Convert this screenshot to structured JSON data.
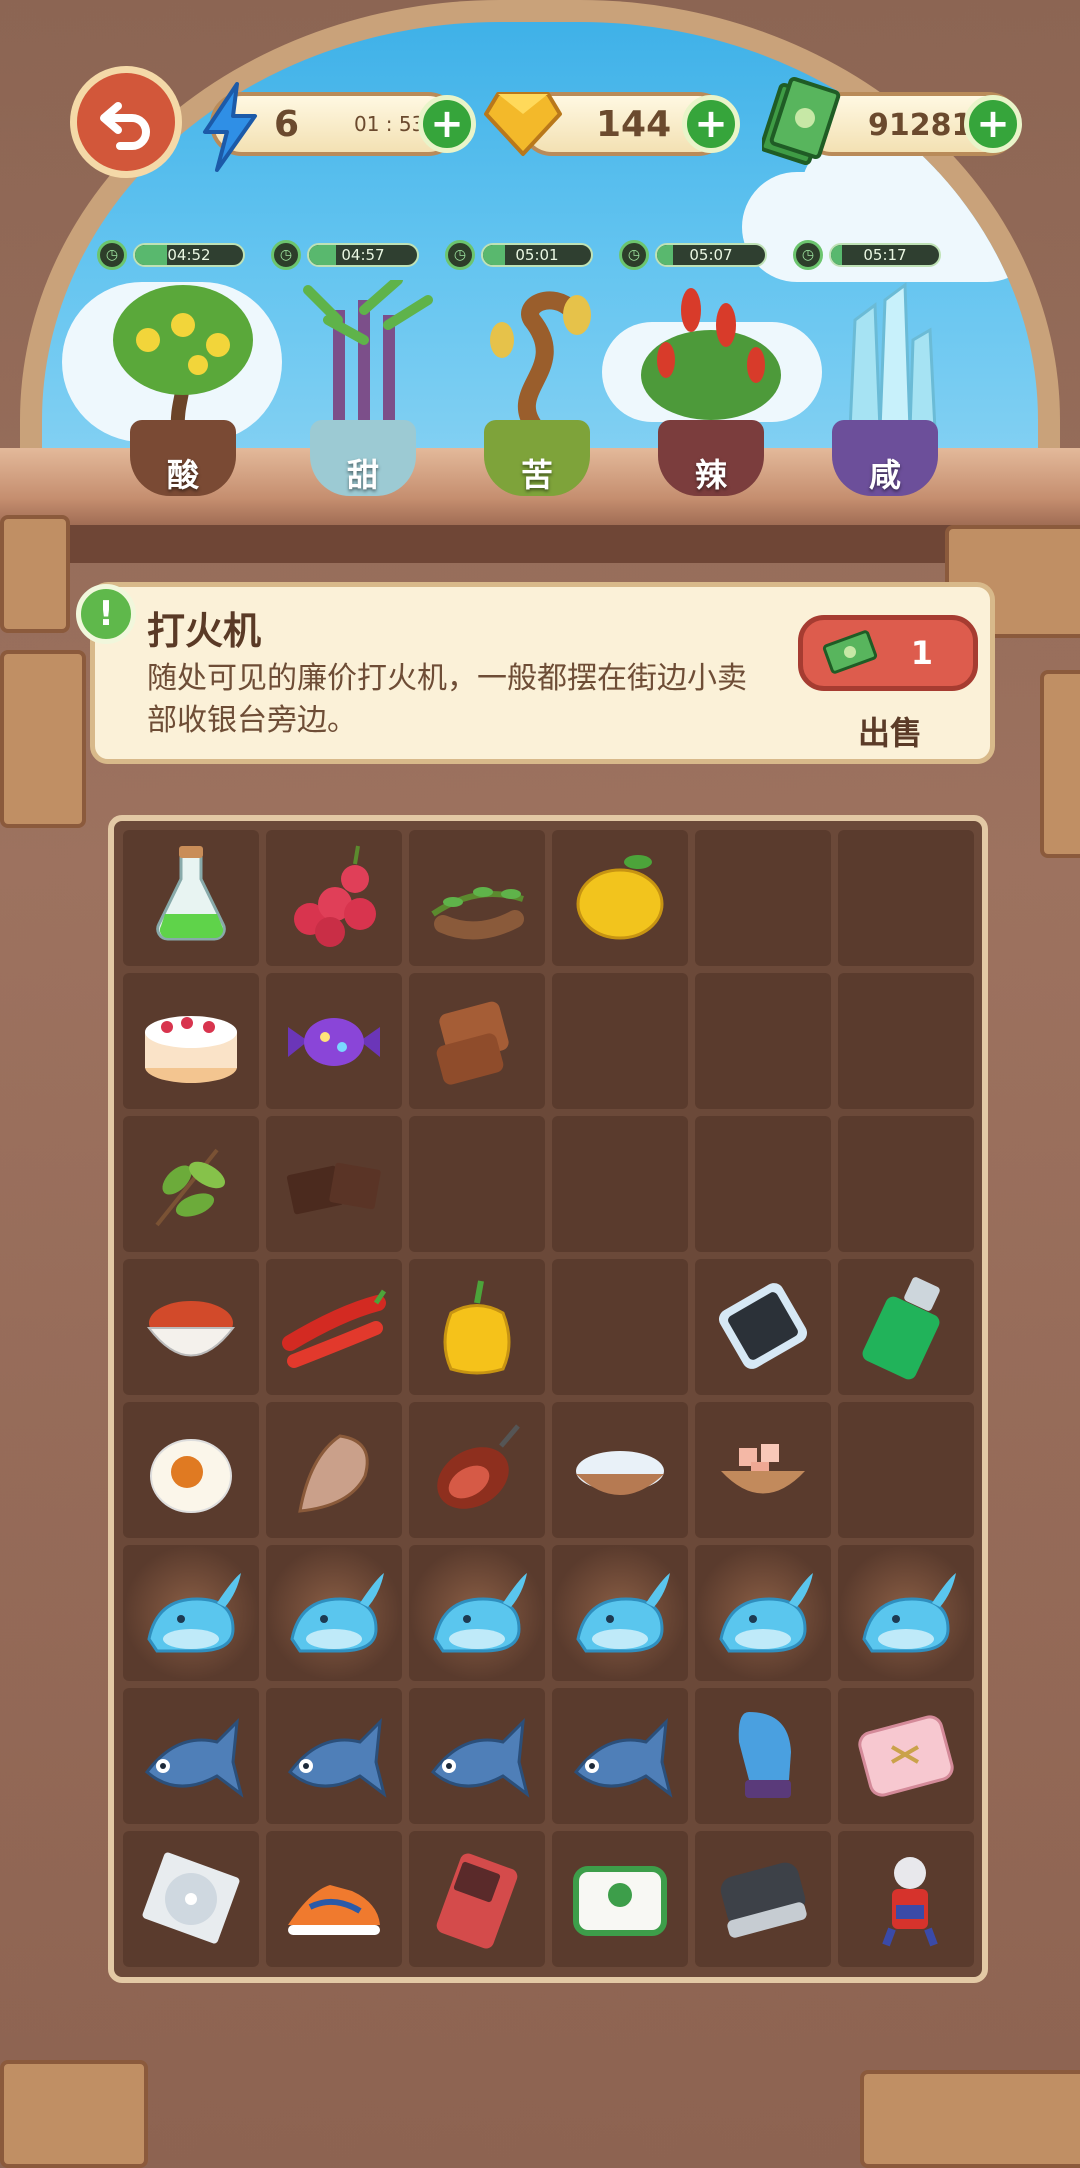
{
  "topbar": {
    "energy": {
      "value": "6",
      "timer": "01 : 53"
    },
    "gems": {
      "value": "144"
    },
    "cash": {
      "value": "912812"
    }
  },
  "plants": [
    {
      "label": "酸",
      "timer": "04:52",
      "progress": 0.3
    },
    {
      "label": "甜",
      "timer": "04:57",
      "progress": 0.25
    },
    {
      "label": "苦",
      "timer": "05:01",
      "progress": 0.2
    },
    {
      "label": "辣",
      "timer": "05:07",
      "progress": 0.15
    },
    {
      "label": "咸",
      "timer": "05:17",
      "progress": 0.1
    }
  ],
  "info": {
    "title": "打火机",
    "description": "随处可见的廉价打火机，一般都摆在街边小卖部收银台旁边。",
    "price": "1",
    "sell_label": "出售"
  },
  "grid": [
    [
      "potion-icon",
      "lychee-icon",
      "tamarind-icon",
      "lemon-icon",
      "",
      ""
    ],
    [
      "cake-icon",
      "candy-icon",
      "brown-sugar-icon",
      "",
      "",
      ""
    ],
    [
      "tea-leaves-icon",
      "chocolate-icon",
      "",
      "",
      "",
      ""
    ],
    [
      "chili-powder-icon",
      "chili-peppers-icon",
      "bell-pepper-icon",
      "",
      "phone-icon",
      "lighter-icon"
    ],
    [
      "salted-egg-icon",
      "dried-fish-icon",
      "ham-icon",
      "salt-bowl-icon",
      "rock-salt-bowl-icon",
      ""
    ],
    [
      "blue-whale-icon",
      "blue-whale-icon",
      "blue-whale-icon",
      "blue-whale-icon",
      "blue-whale-icon",
      "blue-whale-icon"
    ],
    [
      "blue-fish-icon",
      "blue-fish-icon",
      "blue-fish-icon",
      "blue-fish-icon",
      "blue-glove-icon",
      "pink-wallet-icon"
    ],
    [
      "cd-icon",
      "sneaker-icon",
      "gameboy-icon",
      "mahjong-tile-icon",
      "car-key-icon",
      "hero-figure-icon"
    ]
  ],
  "colors": {
    "accent": "#36a53b",
    "sell": "#dd5c4d",
    "sky": "#3fb1e8"
  }
}
